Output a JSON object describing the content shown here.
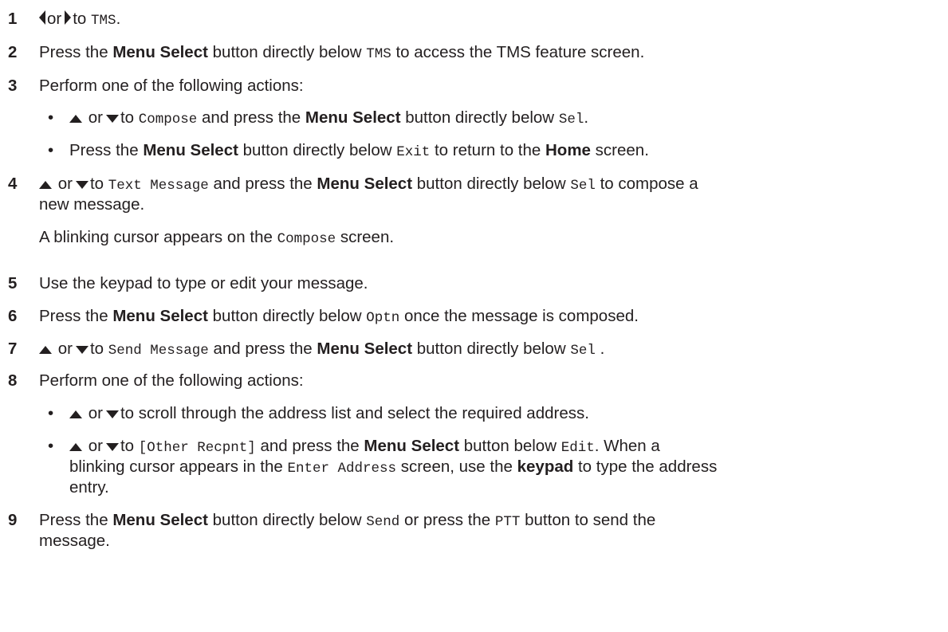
{
  "steps": [
    {
      "n": "1",
      "t": {
        "or": "or",
        "to": "to",
        "tms": "TMS",
        "end": "."
      }
    },
    {
      "n": "2",
      "t": {
        "a": "Press the",
        "b": "Menu Select",
        "c": "button directly below",
        "m": "TMS",
        "d": "to access the TMS feature screen."
      }
    },
    {
      "n": "3",
      "t": {
        "a": "Perform one of the following actions:"
      },
      "bullets": [
        {
          "or": "or",
          "to": "to",
          "m1": "Compose",
          "a": "and press the",
          "b": "Menu Select",
          "c": "button directly below",
          "m2": "Sel",
          "end": "."
        },
        {
          "a": "Press the",
          "b": "Menu Select",
          "c": "button directly below",
          "m": "Exit",
          "d": "to return to the",
          "e": "Home",
          "f": "screen."
        }
      ]
    },
    {
      "n": "4",
      "t": {
        "or": "or",
        "to": "to",
        "m1": "Text Message",
        "a": "and press the",
        "b": "Menu Select",
        "c": "button directly below",
        "m2": "Sel",
        "d": "to compose a",
        "l2": "new message.",
        "p1": "A blinking cursor appears on the",
        "m3": "Compose",
        "p2": "screen."
      }
    },
    {
      "n": "5",
      "t": {
        "a": "Use the keypad to type or edit your message."
      }
    },
    {
      "n": "6",
      "t": {
        "a": "Press the",
        "b": "Menu Select",
        "c": "button directly below",
        "m": "Optn",
        "d": "once the message is composed."
      }
    },
    {
      "n": "7",
      "t": {
        "or": "or",
        "to": "to",
        "m1": "Send Message",
        "a": "and press the",
        "b": "Menu Select",
        "c": "button directly below",
        "m2": "Sel",
        "end": "."
      }
    },
    {
      "n": "8",
      "t": {
        "a": "Perform one of the following actions:"
      },
      "bullets": [
        {
          "or": "or",
          "to": "to scroll through the address list and select the required address."
        },
        {
          "or": "or",
          "to": "to",
          "m1": "[Other Recpnt]",
          "a": "and press the",
          "b": "Menu Select",
          "c": "button below",
          "m2": "Edit",
          "d": ". When a",
          "l2a": "blinking cursor appears in the",
          "m3": "Enter Address",
          "l2b": "screen, use the",
          "l2c": "keypad",
          "l2d": "to type the address",
          "l3": "entry."
        }
      ]
    },
    {
      "n": "9",
      "t": {
        "a": "Press the",
        "b": "Menu Select",
        "c": "button directly below",
        "m": "Send",
        "d": "or press the",
        "m2": "PTT",
        "e": "button to send the",
        "l2": "message."
      }
    }
  ]
}
